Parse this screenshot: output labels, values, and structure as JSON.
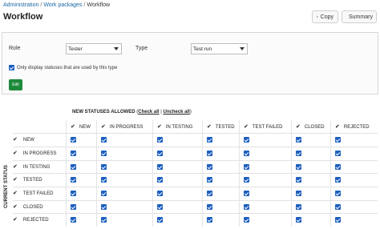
{
  "breadcrumb": {
    "items": [
      "Administration",
      "Work packages"
    ],
    "current": "Workflow",
    "separator": "/"
  },
  "page_title": "Workflow",
  "toolbar": {
    "copy_label": "Copy",
    "summary_label": "Summary"
  },
  "filters": {
    "role_label": "Role",
    "role_value": "Tester",
    "type_label": "Type",
    "type_value": "Test run",
    "only_display_label": "Only display statuses that are used by this type",
    "only_display_checked": true,
    "edit_label": "Edit"
  },
  "matrix": {
    "new_statuses_label": "NEW STATUSES ALLOWED",
    "check_all": "Check all",
    "uncheck_all": "Uncheck all",
    "current_status_label": "CURRENT STATUS",
    "columns": [
      "NEW",
      "IN PROGRESS",
      "IN TESTING",
      "TESTED",
      "TEST FAILED",
      "CLOSED",
      "REJECTED"
    ],
    "rows": [
      "NEW",
      "IN PROGRESS",
      "IN TESTING",
      "TESTED",
      "TEST FAILED",
      "CLOSED",
      "REJECTED"
    ],
    "all_checked": true
  },
  "colors": {
    "link": "#1a67a3",
    "checkbox": "#1d5fbf",
    "edit_button": "#1e8a3c"
  },
  "icons": {
    "copy": "copy-icon",
    "summary": "magnifier-icon",
    "check": "check-mark-icon"
  }
}
